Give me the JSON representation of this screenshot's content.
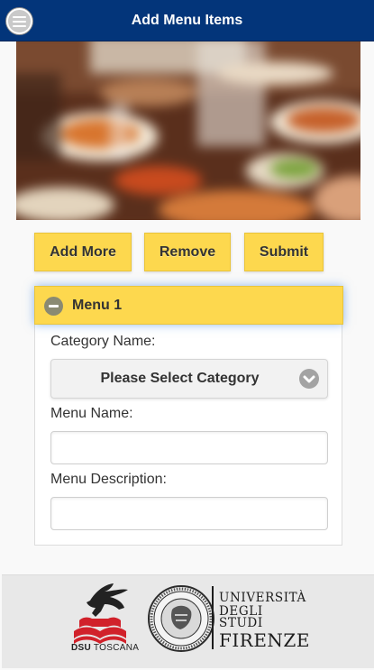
{
  "header": {
    "title": "Add Menu Items",
    "menu_icon": "hamburger-menu-icon",
    "background_color": "#03357a"
  },
  "hero_image": {
    "description_icon": "food-table-photo"
  },
  "actions": {
    "add_more_label": "Add More",
    "remove_label": "Remove",
    "submit_label": "Submit",
    "button_color": "#fdd84e"
  },
  "menu_section": {
    "title": "Menu 1",
    "collapse_icon": "minus-circle-icon",
    "category_label": "Category Name:",
    "category_selected": "Please Select Category",
    "category_icon": "chevron-down-icon",
    "menu_name_label": "Menu Name:",
    "menu_name_value": "",
    "menu_description_label": "Menu Description:",
    "menu_description_value": ""
  },
  "footer": {
    "dsu_brand": "DSU",
    "dsu_region": "TOSCANA",
    "university_line1": "UNIVERSITÀ",
    "university_line2": "DEGLI STUDI",
    "university_line3": "FIRENZE"
  }
}
